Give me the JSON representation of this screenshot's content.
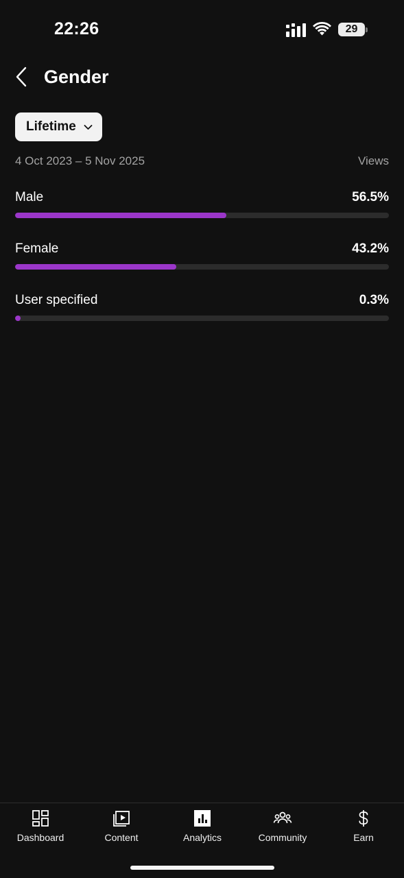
{
  "status_bar": {
    "time": "22:26",
    "battery_level": "29",
    "icons": [
      "signal-icon",
      "wifi-icon",
      "battery-icon"
    ]
  },
  "header": {
    "title": "Gender",
    "back_icon": "chevron-left-icon"
  },
  "filters": {
    "period": "Lifetime",
    "date_range": "4 Oct 2023 – 5 Nov 2025",
    "metric": "Views"
  },
  "colors": {
    "accent": "#9b36c9",
    "background": "#111111",
    "track": "#2c2c2c"
  },
  "genders": [
    {
      "label": "Male",
      "value": "56.5%",
      "fraction": 0.565
    },
    {
      "label": "Female",
      "value": "43.2%",
      "fraction": 0.432
    },
    {
      "label": "User specified",
      "value": "0.3%",
      "fraction": 0.003
    }
  ],
  "bottom_nav": {
    "items": [
      {
        "label": "Dashboard",
        "icon": "dashboard-icon",
        "active": false
      },
      {
        "label": "Content",
        "icon": "content-icon",
        "active": false
      },
      {
        "label": "Analytics",
        "icon": "analytics-icon",
        "active": true
      },
      {
        "label": "Community",
        "icon": "community-icon",
        "active": false
      },
      {
        "label": "Earn",
        "icon": "dollar-icon",
        "active": false
      }
    ]
  }
}
